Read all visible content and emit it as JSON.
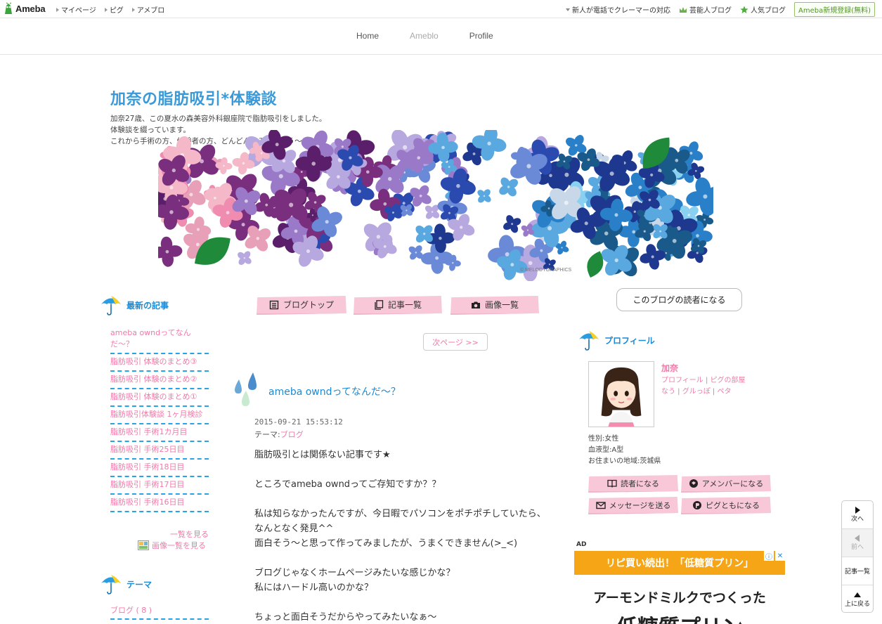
{
  "topbar": {
    "logo": "Ameba",
    "nav": [
      "マイページ",
      "ピグ",
      "アメブロ"
    ],
    "right_items": [
      "新人が電話でクレーマーの対応",
      "芸能人ブログ",
      "人気ブログ"
    ],
    "register": "Ameba新規登録(無料)"
  },
  "blognav": {
    "home": "Home",
    "ameblo": "Ameblo",
    "profile": "Profile"
  },
  "header": {
    "title": "加奈の脂肪吸引*体験談",
    "desc": [
      "加奈27歳、この夏水の森美容外科銀座院で脂肪吸引をしました。",
      "体験談を綴っています。",
      "これから手術の方、体験者の方、どんどん絡みましょう〜♪"
    ],
    "copyright": "© MELODYGRAPHICS"
  },
  "left": {
    "recent_title": "最新の記事",
    "recent": [
      "ameba owndってなんだ〜？",
      "脂肪吸引 体験のまとめ③",
      "脂肪吸引 体験のまとめ②",
      "脂肪吸引 体験のまとめ①",
      "脂肪吸引体験談 1ヶ月検診",
      "脂肪吸引 手術1カ月目",
      "脂肪吸引 手術25日目",
      "脂肪吸引 手術18日目",
      "脂肪吸引 手術17日目",
      "脂肪吸引 手術16日目"
    ],
    "see_list": "一覧を見る",
    "see_images": "画像一覧を見る",
    "theme_title": "テーマ",
    "theme_item": "ブログ ( 8 )"
  },
  "tabs": {
    "top": "ブログトップ",
    "list": "記事一覧",
    "images": "画像一覧"
  },
  "next_page": "次ページ >>",
  "article": {
    "title": "ameba owndってなんだ〜？",
    "datetime": "2015-09-21 15:53:12",
    "theme_label": "テーマ:",
    "theme": "ブログ",
    "body": [
      "脂肪吸引とは関係ない記事です★",
      "",
      "ところでameba owndってご存知ですか？？",
      "",
      "私は知らなかったんですが、今日暇でパソコンをポチポチしていたら、",
      "なんとなく発見^^",
      "面白そう〜と思って作ってみましたが、うまくできません(>_<)",
      "",
      "ブログじゃなくホームページみたいな感じかな？",
      "私にはハードル高いのかな？",
      "",
      "ちょっと面白そうだからやってみたいなぁ〜"
    ]
  },
  "right": {
    "reader_button": "このブログの読者になる",
    "profile_title": "プロフィール",
    "name": "加奈",
    "links": [
      "プロフィール",
      "ピグの部屋",
      "なう",
      "グルっぽ",
      "ペタ"
    ],
    "gender": "性別:女性",
    "blood": "血液型:A型",
    "region": "お住まいの地域:茨城県",
    "buttons": {
      "reader": "読者になる",
      "member": "アメンバーになる",
      "message": "メッセージを送る",
      "pigg": "ピグともになる"
    },
    "ad_label": "AD",
    "ad_band": "リピ買い続出！「低糖質プリン」",
    "ad_line1": "アーモンドミルクでつくった",
    "ad_line2": "低糖質プリン"
  },
  "pager": {
    "next": "次へ",
    "prev": "前へ",
    "list": "記事一覧",
    "top": "上に戻る"
  },
  "colors": {
    "accent_blue": "#1a8bd6",
    "pink_link": "#f07aa8",
    "tab_pink": "#f8c8d8",
    "title_blue": "#3a9ad9"
  }
}
